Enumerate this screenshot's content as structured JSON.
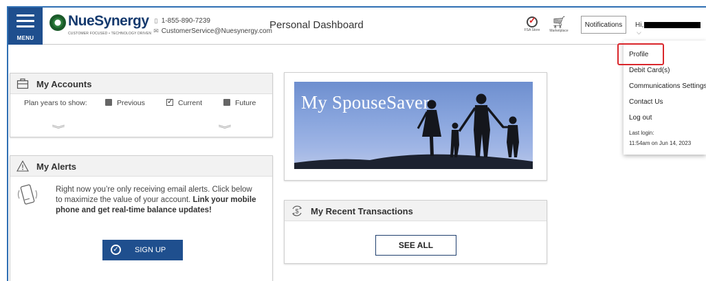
{
  "header": {
    "menu_label": "MENU",
    "brand_name": "NueSynergy",
    "brand_tagline": "CUSTOMER FOCUSED • TECHNOLOGY DRIVEN",
    "phone": "1-855-890-7239",
    "email": "CustomerService@Nuesynergy.com",
    "page_title": "Personal Dashboard",
    "fsa_store_label": "FSA Store",
    "marketplace_label": "Marketplace",
    "notifications_label": "Notifications",
    "greeting": "Hi,"
  },
  "user_menu": {
    "items": [
      "Profile",
      "Debit Card(s)",
      "Communications Settings",
      "Contact Us",
      "Log out"
    ],
    "last_login_label": "Last login:",
    "last_login_value": "11:54am on Jun 14, 2023"
  },
  "accounts": {
    "title": "My Accounts",
    "plan_years_label": "Plan years to show:",
    "options": [
      {
        "label": "Previous",
        "checked": false
      },
      {
        "label": "Current",
        "checked": true
      },
      {
        "label": "Future",
        "checked": false
      }
    ]
  },
  "alerts": {
    "title": "My Alerts",
    "message_plain": "Right now you’re only receiving email alerts. Click below to maximize the value of your account.",
    "message_bold": "Link your mobile phone and get real-time balance updates!",
    "signup_label": "SIGN UP"
  },
  "spouse_saver": {
    "banner_text": "My SpouseSaver"
  },
  "transactions": {
    "title": "My Recent Transactions",
    "see_all_label": "SEE ALL"
  },
  "colors": {
    "brand_navy": "#1f4f8e",
    "frame_blue": "#2f6fb3",
    "highlight_red": "#d9262b",
    "banner_sky": "#8aa6de"
  },
  "icons": {
    "menu": "hamburger-icon",
    "phone": "phone-icon",
    "email": "envelope-icon",
    "fsa_store": "fsa-check-icon",
    "marketplace": "cart-icon",
    "accounts": "briefcase-icon",
    "alerts": "warning-triangle-icon",
    "mobile": "mobile-phone-icon",
    "signup": "check-circle-icon",
    "transactions": "dollar-exchange-icon"
  }
}
